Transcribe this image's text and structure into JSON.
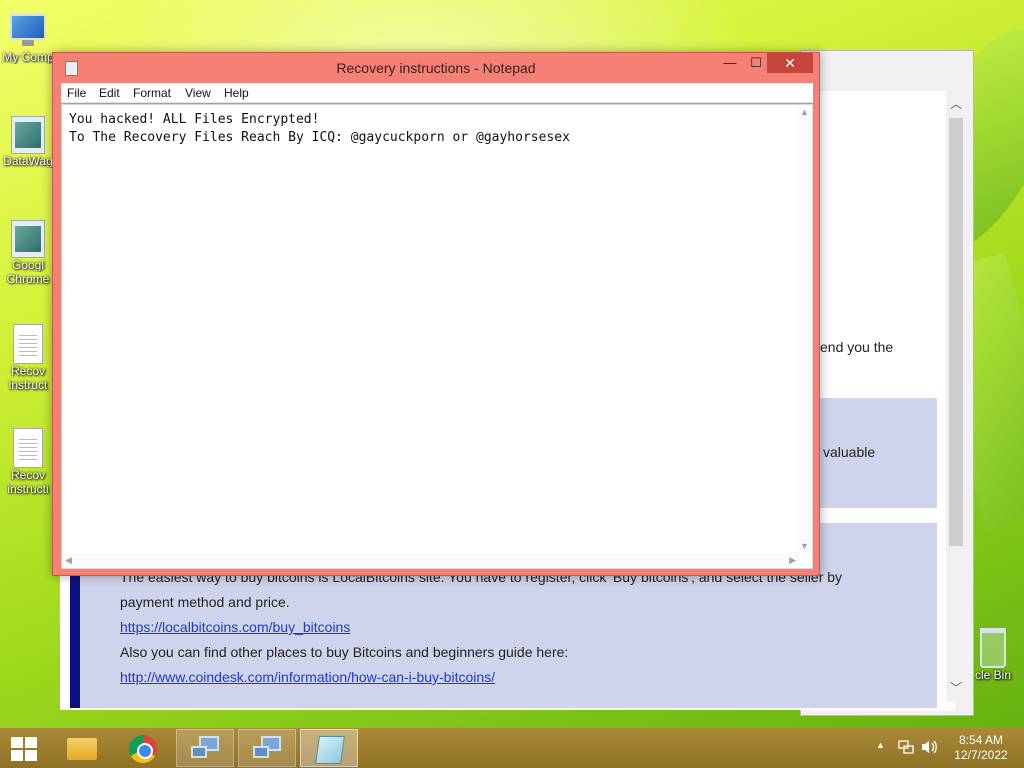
{
  "desktop": {
    "icons": [
      {
        "label": "My Comp",
        "icon": "computer-icon"
      },
      {
        "label": "DataWag",
        "icon": "app-icon"
      },
      {
        "label": "Googl",
        "label2": "Chrome",
        "icon": "app-icon"
      },
      {
        "label": "Recov",
        "label2": "instruct",
        "icon": "text-document-icon"
      },
      {
        "label": "Recov",
        "label2": "instructi",
        "icon": "text-document-icon"
      }
    ],
    "recycle_bin_label": "cle Bin"
  },
  "notepad": {
    "title": "Recovery instructions - Notepad",
    "controls": {
      "minimize": "—",
      "maximize": "☐",
      "close": "✕"
    },
    "menu": [
      "File",
      "Edit",
      "Format",
      "View",
      "Help"
    ],
    "text_lines": [
      "You hacked! ALL Files Encrypted!",
      "To The Recovery Files Reach By ICQ: @gaycuckporn or @gayhorsesex"
    ]
  },
  "background_page": {
    "fragment_1": "end you the",
    "fragment_2": "valuable",
    "btc_line_1": "The easiest way to buy bitcoins is LocalBitcoins site. You have to register, click 'Buy bitcoins', and select the seller by",
    "btc_line_2": "payment method and price.",
    "btc_link_1": "https://localbitcoins.com/buy_bitcoins",
    "btc_line_3": "Also you can find other places to buy Bitcoins and beginners guide here:",
    "btc_link_2": "http://www.coindesk.com/information/how-can-i-buy-bitcoins/"
  },
  "taskbar": {
    "clock_time": "8:54 AM",
    "clock_date": "12/7/2022",
    "tray_chevron": "▲"
  }
}
